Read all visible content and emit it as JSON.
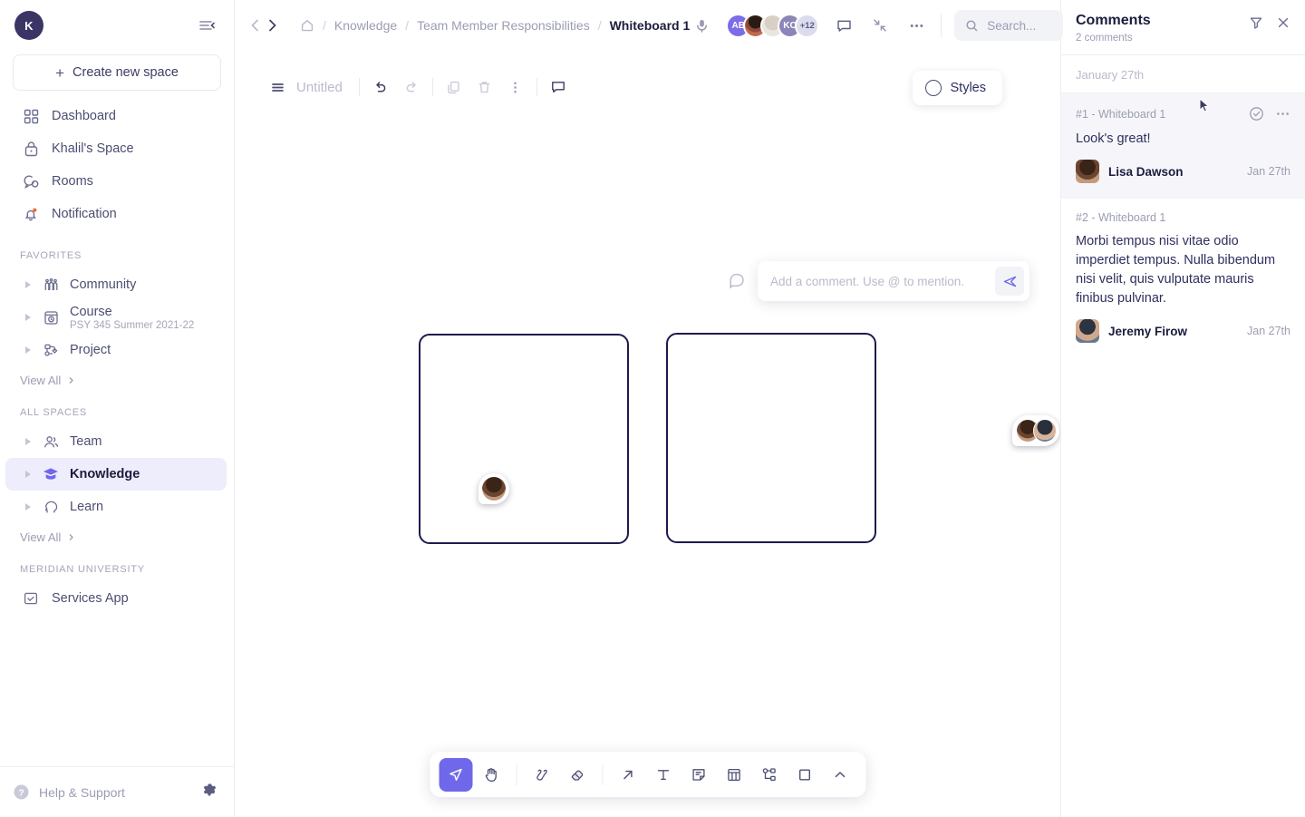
{
  "sidebar": {
    "user_initial": "K",
    "collapse_icon": "collapse-sidebar-icon",
    "create_label": "Create new space",
    "nav": [
      {
        "label": "Dashboard",
        "icon": "grid-icon"
      },
      {
        "label": "Khalil's Space",
        "icon": "lock-icon"
      },
      {
        "label": "Rooms",
        "icon": "chat-rooms-icon"
      },
      {
        "label": "Notification",
        "icon": "bell-icon"
      }
    ],
    "favorites_label": "FAVORITES",
    "favorites": [
      {
        "label": "Community",
        "sub": "",
        "icon": "community-icon"
      },
      {
        "label": "Course",
        "sub": "PSY 345 Summer 2021-22",
        "icon": "course-icon"
      },
      {
        "label": "Project",
        "sub": "",
        "icon": "project-icon"
      }
    ],
    "favorites_view_all": "View All",
    "all_spaces_label": "ALL SPACES",
    "all_spaces": [
      {
        "label": "Team",
        "sub": "",
        "icon": "team-icon",
        "active": false
      },
      {
        "label": "Knowledge",
        "sub": "",
        "icon": "graduation-cap-icon",
        "active": true
      },
      {
        "label": "Learn",
        "sub": "",
        "icon": "head-idea-icon",
        "active": false
      }
    ],
    "all_spaces_view_all": "View All",
    "org_label": "MERIDIAN UNIVERSITY",
    "org_items": [
      {
        "label": "Services App",
        "icon": "services-app-icon"
      }
    ],
    "help_label": "Help & Support",
    "settings_icon": "gear-icon"
  },
  "header": {
    "back_icon": "chevron-left-icon",
    "forward_icon": "chevron-right-icon",
    "home_icon": "home-icon",
    "breadcrumbs": [
      {
        "label": "Knowledge",
        "current": false
      },
      {
        "label": "Team Member Responsibilities",
        "current": false
      },
      {
        "label": "Whiteboard 1",
        "current": true
      }
    ],
    "separator": "/",
    "mic_icon": "microphone-icon",
    "avatars": [
      {
        "initials": "AB",
        "type": "initials",
        "color": "#7b6ce8"
      },
      {
        "initials": "",
        "type": "photo",
        "color": "#6b4530"
      },
      {
        "initials": "",
        "type": "photo",
        "color": "#d8d4cc"
      },
      {
        "initials": "KO",
        "type": "initials",
        "color": "#8b86b8"
      },
      {
        "initials": "+12",
        "type": "more",
        "color": "#dbdced"
      }
    ],
    "comment_icon": "comment-bubble-icon",
    "collapse_icon": "collapse-arrows-icon",
    "more_icon": "more-horizontal-icon",
    "search_placeholder": "Search...",
    "search_value": "",
    "search_icon": "search-icon"
  },
  "whiteboard": {
    "menu_icon": "hamburger-menu-icon",
    "title": "Untitled",
    "undo_icon": "undo-icon",
    "redo_icon": "redo-icon",
    "copy_icon": "copy-icon",
    "delete_icon": "trash-icon",
    "more_icon": "more-vertical-icon",
    "comment_icon": "comment-bubble-icon",
    "styles_label": "Styles",
    "styles_icon": "circle-icon",
    "compose": {
      "bubble_icon": "comment-pin-icon",
      "placeholder": "Add a comment. Use @ to mention.",
      "value": "",
      "send_icon": "send-icon"
    },
    "shapes": [
      {
        "name": "rectangle-1",
        "border_color": "#1c1a4f"
      },
      {
        "name": "rectangle-2",
        "border_color": "#1c1a4f"
      }
    ],
    "tools": [
      {
        "name": "select-tool",
        "icon": "cursor-arrow-icon",
        "active": true
      },
      {
        "name": "hand-tool",
        "icon": "hand-icon",
        "active": false
      },
      {
        "name": "pen-tool",
        "icon": "pen-scribble-icon",
        "active": false
      },
      {
        "name": "eraser-tool",
        "icon": "eraser-icon",
        "active": false
      },
      {
        "name": "arrow-tool",
        "icon": "arrow-up-right-icon",
        "active": false
      },
      {
        "name": "text-tool",
        "icon": "text-t-icon",
        "active": false
      },
      {
        "name": "sticky-note-tool",
        "icon": "sticky-note-icon",
        "active": false
      },
      {
        "name": "table-tool",
        "icon": "table-icon",
        "active": false
      },
      {
        "name": "diagram-tool",
        "icon": "flowchart-icon",
        "active": false
      },
      {
        "name": "shape-tool",
        "icon": "square-icon",
        "active": false
      },
      {
        "name": "expand-toolbar",
        "icon": "chevron-up-icon",
        "active": false
      }
    ],
    "active_tool_color": "#6f68ea"
  },
  "comments_panel": {
    "title": "Comments",
    "count_label": "2 comments",
    "filter_icon": "filter-icon",
    "close_icon": "close-icon",
    "date_group": "January 27th",
    "items": [
      {
        "ref": "#1 - Whiteboard 1",
        "body": "Look's great!",
        "author": "Lisa Dawson",
        "time": "Jan 27th",
        "selected": true,
        "resolve_icon": "check-circle-icon",
        "more_icon": "more-horizontal-icon"
      },
      {
        "ref": "#2 - Whiteboard 1",
        "body": "Morbi tempus nisi vitae odio imperdiet tempus. Nulla bibendum nisi velit, quis vulputate mauris finibus pulvinar.",
        "author": "Jeremy Firow",
        "time": "Jan 27th",
        "selected": false,
        "resolve_icon": "",
        "more_icon": ""
      }
    ]
  },
  "colors": {
    "accent": "#6f68ea",
    "accent_light": "#eeedfb",
    "ink": "#1b1c3d",
    "muted": "#9b9db3",
    "shape_border": "#1c1a4f"
  }
}
